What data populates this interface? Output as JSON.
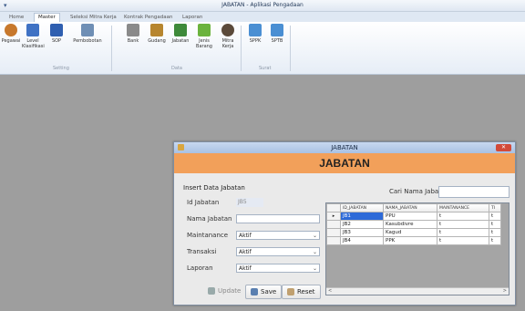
{
  "app": {
    "title": "JABATAN - Aplikasi Pengadaan"
  },
  "ribbon": {
    "tabs": [
      "Home",
      "Master",
      "Seleksi Mitra Kerja",
      "Kontrak Pengadaan",
      "Laporan"
    ],
    "active_tab": "Master",
    "buttons": [
      {
        "label": "Pegawai",
        "icon": "users-icon",
        "color": "#c7782c"
      },
      {
        "label": "Level Klasifikasi",
        "icon": "chart-icon",
        "color": "#3f72c4"
      },
      {
        "label": "SOP",
        "icon": "book-icon",
        "color": "#2f5fb0"
      },
      {
        "label": "Pembobotan",
        "icon": "scale-icon",
        "color": "#6f8fb5"
      },
      {
        "label": "Bank",
        "icon": "bank-icon",
        "color": "#8a8a8a"
      },
      {
        "label": "Gudang",
        "icon": "box-icon",
        "color": "#b7862f"
      },
      {
        "label": "Jabatan",
        "icon": "people-icon",
        "color": "#3e8a3a"
      },
      {
        "label": "Jenis Barang",
        "icon": "add-item-icon",
        "color": "#6bb33d"
      },
      {
        "label": "Mitra Kerja",
        "icon": "person-icon",
        "color": "#5b4a3a"
      },
      {
        "label": "SPPK",
        "icon": "doc-icon",
        "color": "#4a8fd3"
      },
      {
        "label": "SPTB",
        "icon": "doc-icon",
        "color": "#4a8fd3"
      }
    ],
    "groups": [
      "Setting",
      "Data",
      "Surat"
    ]
  },
  "dialog": {
    "title": "JABATAN",
    "header": "JABATAN",
    "form": {
      "section": "Insert Data Jabatan",
      "id_label": "Id Jabatan",
      "id_value": "JB5",
      "nama_label": "Nama Jabatan",
      "nama_value": "",
      "maint_label": "Maintanance",
      "maint_value": "Aktif",
      "transaksi_label": "Transaksi",
      "transaksi_value": "Aktif",
      "laporan_label": "Laporan",
      "laporan_value": "Aktif",
      "update_label": "Update",
      "save_label": "Save",
      "reset_label": "Reset"
    },
    "search": {
      "label": "Cari Nama Jabatan",
      "value": ""
    },
    "grid": {
      "columns": [
        "ID_JABATAN",
        "NAMA_JABATAN",
        "MAINTANANCE",
        "TI"
      ],
      "rows": [
        [
          "JB1",
          "PPU",
          "t",
          "t"
        ],
        [
          "JB2",
          "Kasubdivre",
          "t",
          "t"
        ],
        [
          "JB3",
          "Kagud",
          "t",
          "t"
        ],
        [
          "JB4",
          "PPK",
          "t",
          "t"
        ]
      ]
    }
  }
}
